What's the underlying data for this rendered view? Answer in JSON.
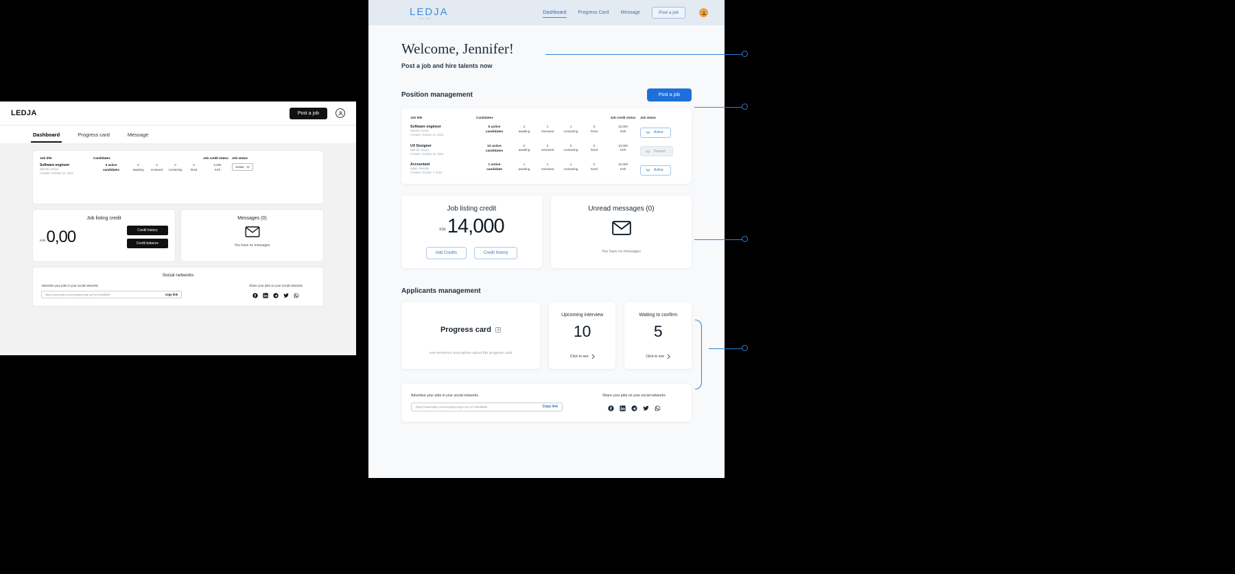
{
  "small_mock": {
    "logo": "LEDJA",
    "post_job": "Post a job",
    "tabs": [
      {
        "label": "Dashboard",
        "active": true
      },
      {
        "label": "Progress card",
        "active": false
      },
      {
        "label": "Message",
        "active": false
      }
    ],
    "table": {
      "headers": [
        "Job title",
        "Candidates",
        "Job credit status",
        "Job status"
      ],
      "rows": [
        {
          "title": "Software engineer",
          "location": "Nairobi, Kenya",
          "created": "Created: October 21, 2022",
          "active": "0 active\ncandidates",
          "awaiting": "0",
          "awaiting_label": "awaiting",
          "reviewed": "0",
          "reviewed_label": "reviewed",
          "contacting": "0",
          "contacting_label": "contacting",
          "hired": "0",
          "hired_label": "hired",
          "credit": "5,000\nKSh",
          "status": "Active"
        }
      ]
    },
    "credit_card": {
      "title": "Job listing credit",
      "currency": "KSh",
      "amount": "0,00",
      "btn_history": "Credit history",
      "btn_balance": "Credit balance"
    },
    "messages_card": {
      "title": "Messages (0)",
      "empty": "You have no messages"
    },
    "social": {
      "title": "Social networks",
      "advertise_label": "Advertise your jobs in your social networks",
      "url": "https://www.ledja.co.ke/employer/sign-up?ref=064d8569",
      "copy": "copy link",
      "share_label": "Share your jobs on your social networks",
      "icons": [
        "facebook-icon",
        "linkedin-icon",
        "telegram-icon",
        "twitter-icon",
        "whatsapp-icon"
      ]
    }
  },
  "big_mock": {
    "logo": "LEDJA",
    "logo_tagline": "Hire Fast",
    "nav": [
      {
        "label": "Dashboard",
        "active": true
      },
      {
        "label": "Progress Card",
        "active": false
      },
      {
        "label": "Message",
        "active": false
      }
    ],
    "post_job": "Post a job",
    "welcome": "Welcome, Jennifer!",
    "subtitle": "Post a job and hire talents now",
    "position_section": {
      "title": "Position management",
      "post_job_btn": "Post a job",
      "headers": [
        "Job title",
        "Candidates",
        "Job credit status",
        "Job status"
      ],
      "rows": [
        {
          "title": "Software engineer",
          "location": "Nairobi, Kenya",
          "created": "Created: October 21, 2022",
          "active": "5 active",
          "active2": "candidates",
          "awaiting": "2",
          "awaiting_label": "awaiting",
          "reviewed": "1",
          "reviewed_label": "reviewed",
          "contacting": "1",
          "contacting_label": "contacting",
          "hired": "0",
          "hired_label": "hired",
          "credit": "10,000",
          "credit_unit": "KSh",
          "status": "Active",
          "status_kind": "active"
        },
        {
          "title": "UX Designer",
          "location": "Nairobi, Kenya",
          "created": "Created: October 15, 2022",
          "active": "10 active",
          "active2": "candidates",
          "awaiting": "0",
          "awaiting_label": "awaiting",
          "reviewed": "0",
          "reviewed_label": "reviewed",
          "contacting": "0",
          "contacting_label": "contacting",
          "hired": "0",
          "hired_label": "hired",
          "credit": "10,000",
          "credit_unit": "KSh",
          "status": "Paused",
          "status_kind": "paused"
        },
        {
          "title": "Accountant",
          "location": "Kigali, Rwanda",
          "created": "Created: October 7, 2022",
          "active": "1 active",
          "active2": "candidate",
          "awaiting": "1",
          "awaiting_label": "awaiting",
          "reviewed": "1",
          "reviewed_label": "reviewed",
          "contacting": "1",
          "contacting_label": "contacting",
          "hired": "0",
          "hired_label": "hired",
          "credit": "10,000",
          "credit_unit": "KSh",
          "status": "Active",
          "status_kind": "active"
        }
      ]
    },
    "credit_card": {
      "title": "Job listing credit",
      "currency": "KSh",
      "amount": "14,000",
      "btn_add": "Add Credits",
      "btn_history": "Credit history"
    },
    "messages_card": {
      "title": "Unread messages (0)",
      "empty": "You have no messages"
    },
    "applicants_section": {
      "title": "Applicants management",
      "progress_card": {
        "title": "Progress card",
        "icon": "external-link-icon",
        "desc": "one-sentence description about the progress card"
      },
      "upcoming": {
        "title": "Upcoming interview",
        "value": "10",
        "link": "Click to see"
      },
      "waiting": {
        "title": "Waiting to confirm",
        "value": "5",
        "link": "Click to see"
      }
    },
    "social": {
      "advertise_label": "Advertise your jobs in your social networks",
      "url": "https://www.ledja.co.ke/employer/sign-up?ref=064d8569",
      "copy": "Copy link",
      "share_label": "Share your jobs on your social networks",
      "icons": [
        "facebook-icon",
        "linkedin-icon",
        "telegram-icon",
        "twitter-icon",
        "whatsapp-icon"
      ]
    }
  },
  "annotations": [
    {
      "name": "callout-welcome"
    },
    {
      "name": "callout-post-a-job"
    },
    {
      "name": "callout-credit-messages"
    },
    {
      "name": "callout-applicants"
    }
  ]
}
